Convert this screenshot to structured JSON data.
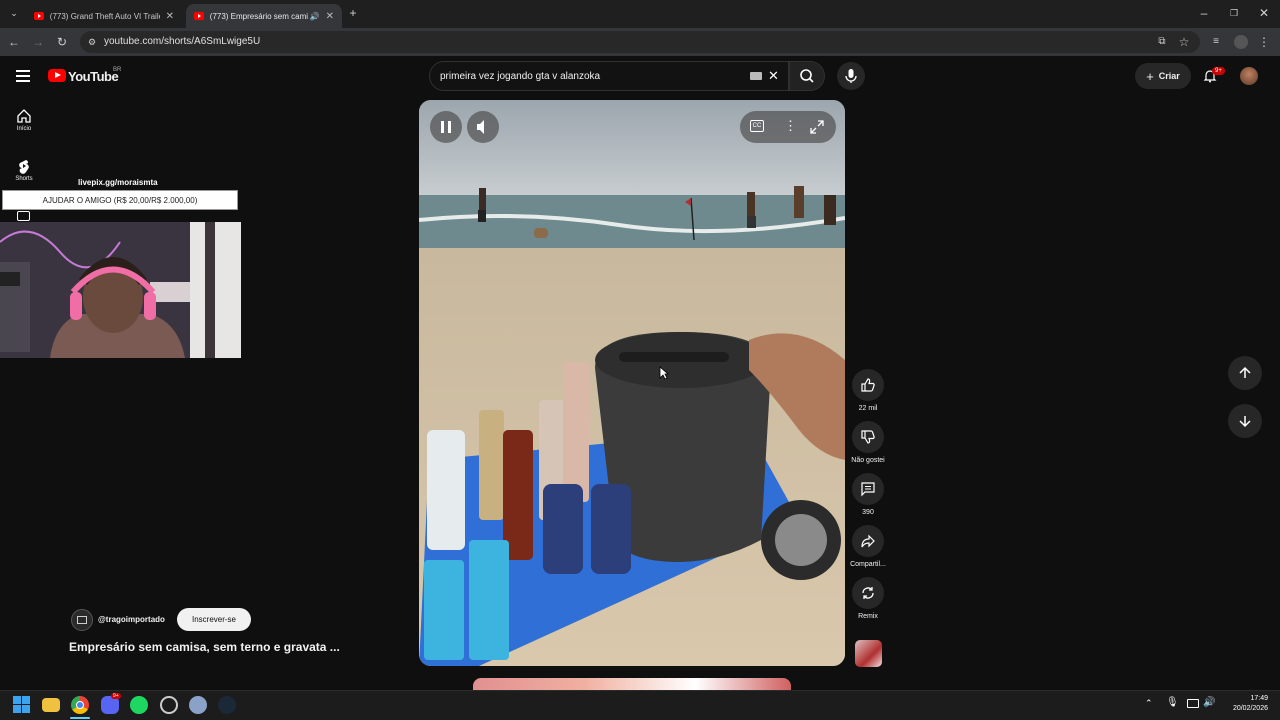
{
  "browser": {
    "tabs": [
      {
        "title": "(773) Grand Theft Auto VI Traile",
        "active": false
      },
      {
        "title": "(773) Empresário sem cami",
        "active": true
      }
    ],
    "url": "youtube.com/shorts/A6SmLwige5U"
  },
  "youtube": {
    "logo_text": "YouTube",
    "region": "BR",
    "search_value": "primeira vez jogando gta v alanzoka",
    "create_label": "Criar",
    "notification_count": "9+",
    "sidebar": [
      {
        "label": "Início",
        "icon": "home-icon"
      },
      {
        "label": "Shorts",
        "icon": "shorts-icon"
      }
    ]
  },
  "stream_overlay": {
    "livepix_text": "livepix.gg/moraismta",
    "donation_text": "AJUDAR O AMIGO (R$ 20,00/R$ 2.000,00)"
  },
  "short": {
    "channel": "@tragoimportado",
    "subscribe_label": "Inscrever-se",
    "title": "Empresário sem camisa, sem terno e gravata ...",
    "actions": {
      "likes": "22 mil",
      "dislike": "Não gostei",
      "comments": "390",
      "share": "Compartil...",
      "remix": "Remix"
    }
  },
  "taskbar": {
    "time": "17:49",
    "date": "20/02/2026",
    "discord_badge": "9+"
  }
}
